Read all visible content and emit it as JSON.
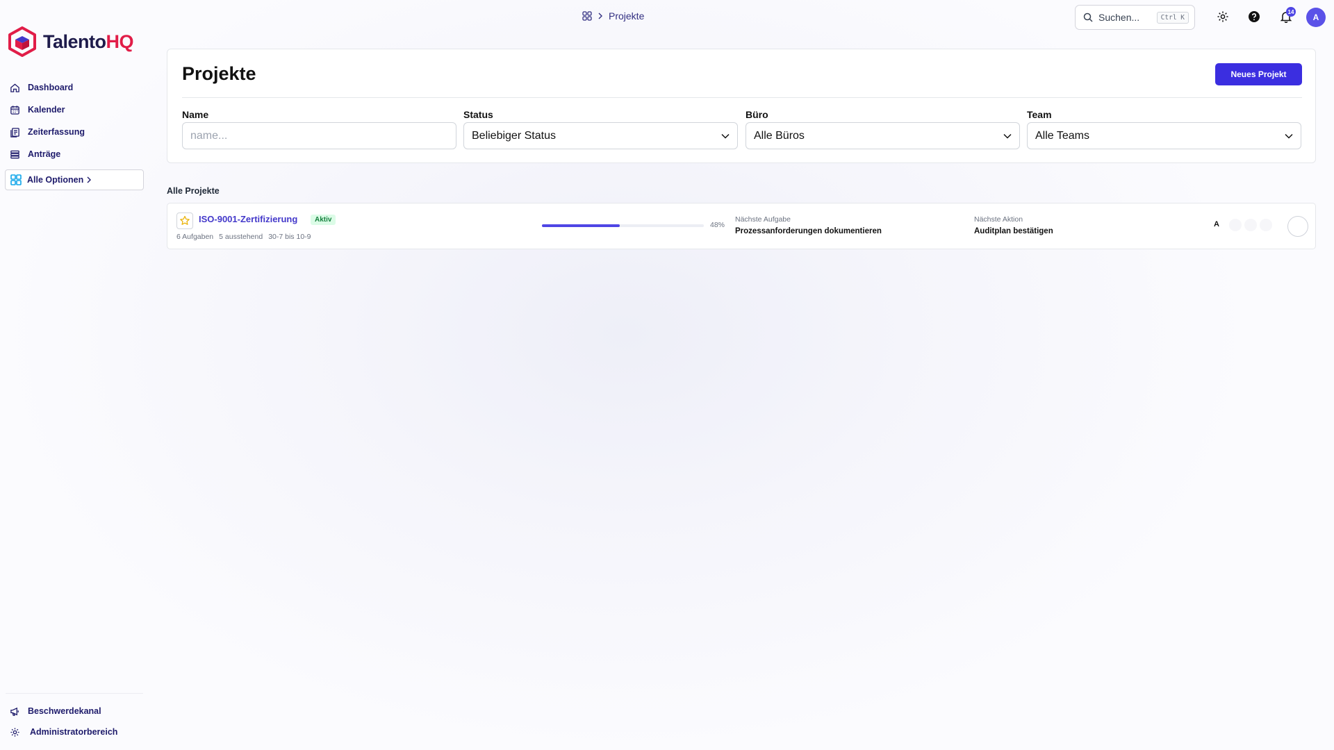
{
  "app": {
    "logo_part1": "Talento",
    "logo_part2": "HQ"
  },
  "sidebar": {
    "items": [
      {
        "label": "Dashboard",
        "icon": "home-icon"
      },
      {
        "label": "Kalender",
        "icon": "calendar-icon"
      },
      {
        "label": "Zeiterfassung",
        "icon": "clipboard-icon"
      },
      {
        "label": "Anträge",
        "icon": "stack-icon"
      }
    ],
    "all_options": "Alle Optionen",
    "bottom_items": [
      {
        "label": "Beschwerdekanal",
        "icon": "megaphone-icon"
      },
      {
        "label": "Administratorbereich",
        "icon": "gear-icon"
      }
    ]
  },
  "topbar": {
    "breadcrumb": "Projekte",
    "search_placeholder": "Suchen...",
    "search_shortcut": "Ctrl K",
    "notification_count": "14",
    "avatar_initial": "A"
  },
  "page": {
    "title": "Projekte",
    "new_button": "Neues Projekt",
    "filters": {
      "name_label": "Name",
      "name_placeholder": "name...",
      "status_label": "Status",
      "status_value": "Beliebiger Status",
      "office_label": "Büro",
      "office_value": "Alle Büros",
      "team_label": "Team",
      "team_value": "Alle Teams"
    },
    "section_title": "Alle Projekte"
  },
  "projects": [
    {
      "name": "ISO-9001-Zertifizierung",
      "status": "Aktiv",
      "tasks": "6 Aufgaben",
      "pending": "5 ausstehend",
      "dates": "30-7 bis 10-9",
      "progress": 48,
      "progress_label": "48%",
      "next_task_label": "Nächste Aufgabe",
      "next_task": "Prozessanforderungen dokumentieren",
      "next_action_label": "Nächste Aktion",
      "next_action": "Auditplan bestätigen",
      "assignee": "A"
    }
  ],
  "colors": {
    "accent": "#3b2ee0",
    "brand_red": "#e11d48",
    "nav_text": "#1e1b6b",
    "status_green": "#15803d"
  }
}
